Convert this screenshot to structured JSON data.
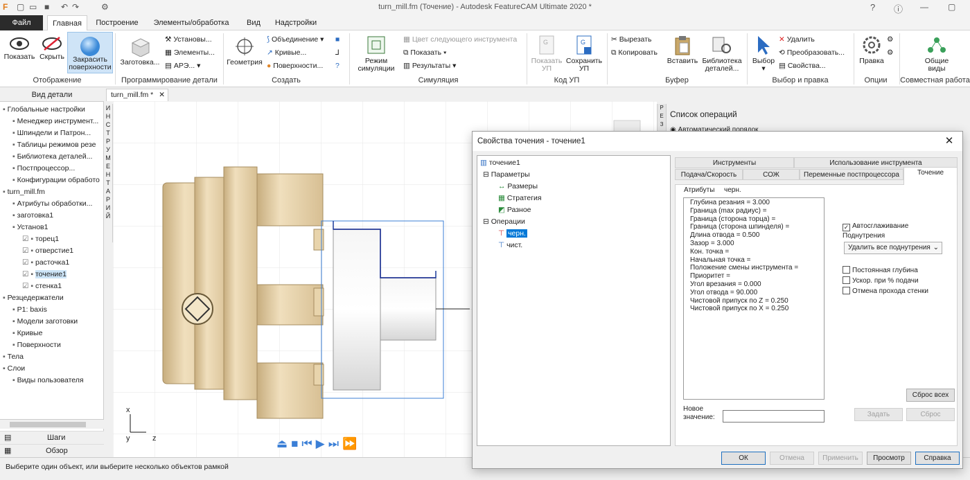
{
  "window": {
    "title": "turn_mill.fm (Точение) - Autodesk FeatureCAM Ultimate 2020 *"
  },
  "menu": {
    "file": "Файл",
    "tabs": [
      "Главная",
      "Построение",
      "Элементы/обработка",
      "Вид",
      "Надстройки"
    ]
  },
  "ribbon": {
    "display": {
      "show": "Показать",
      "hide": "Скрыть",
      "shade": "Закрасить\nповерхности",
      "label": "Отображение"
    },
    "partprog": {
      "stock": "Заготовка...",
      "setups": "Установы...",
      "features": "Элементы...",
      "ape": "АРЭ...",
      "label": "Программирование детали"
    },
    "create": {
      "geometry": "Геометрия",
      "union": "Объединение",
      "curves": "Кривые...",
      "surfaces": "Поверхности...",
      "label": "Создать"
    },
    "sim": {
      "mode": "Режим\nсимуляции",
      "next_tool_color": "Цвет следующего инструмента",
      "show": "Показать",
      "results": "Результаты",
      "label": "Симуляция"
    },
    "nc": {
      "show_nc": "Показать\nУП",
      "save_nc": "Сохранить\nУП",
      "label": "Код УП"
    },
    "clipboard": {
      "cut": "Вырезать",
      "copy": "Копировать",
      "paste": "Вставить",
      "library": "Библиотека\nдеталей...",
      "label": "Буфер"
    },
    "select": {
      "select": "Выбор",
      "delete": "Удалить",
      "transform": "Преобразовать...",
      "properties": "Свойства...",
      "label": "Выбор и правка"
    },
    "options": {
      "edit": "Правка",
      "label": "Опции"
    },
    "collab": {
      "shared_views": "Общие\nвиды",
      "label": "Совместная работа"
    }
  },
  "left_panel": {
    "header": "Вид детали",
    "tree": [
      {
        "label": "Глобальные настройки",
        "level": 0
      },
      {
        "label": "Менеджер инструмент...",
        "level": 1
      },
      {
        "label": "Шпиндели и Патрон...",
        "level": 1
      },
      {
        "label": "Таблицы режимов резе",
        "level": 1
      },
      {
        "label": "Библиотека деталей...",
        "level": 1
      },
      {
        "label": "Постпроцессор...",
        "level": 1
      },
      {
        "label": "Конфигурации обработо",
        "level": 1
      },
      {
        "label": "turn_mill.fm",
        "level": 0
      },
      {
        "label": "Атрибуты обработки...",
        "level": 1
      },
      {
        "label": "заготовка1",
        "level": 1
      },
      {
        "label": "Установ1",
        "level": 1
      },
      {
        "label": "торец1",
        "level": 2
      },
      {
        "label": "отверстие1",
        "level": 2
      },
      {
        "label": "расточка1",
        "level": 2
      },
      {
        "label": "точение1",
        "level": 2
      },
      {
        "label": "стенка1",
        "level": 2
      },
      {
        "label": "Резцедержатели",
        "level": 0
      },
      {
        "label": "P1: baxis",
        "level": 1
      },
      {
        "label": "Модели заготовки",
        "level": 1
      },
      {
        "label": "Кривые",
        "level": 1
      },
      {
        "label": "Поверхности",
        "level": 1
      },
      {
        "label": "Тела",
        "level": 0
      },
      {
        "label": "Слои",
        "level": 0
      },
      {
        "label": "Виды пользователя",
        "level": 1
      }
    ],
    "bottom": {
      "steps": "Шаги",
      "overview": "Обзор"
    },
    "vertical_tab": "ИНСТРУМЕНТАРИЙ"
  },
  "document": {
    "tab": "turn_mill.fm *"
  },
  "viewport": {
    "axis_x": "x",
    "axis_y": "y",
    "axis_z": "z"
  },
  "right_panel": {
    "title": "Список операций",
    "auto_order": "Автоматический порядок"
  },
  "dialog": {
    "title": "Свойства точения - точение1",
    "close": "✕",
    "tree": {
      "root": "точение1",
      "params": "Параметры",
      "sizes": "Размеры",
      "strategy": "Стратегия",
      "misc": "Разное",
      "operations": "Операции",
      "rough": "черн.",
      "finish": "чист."
    },
    "tabs_row1": [
      "Инструменты",
      "Использование инструмента"
    ],
    "tabs_row2": [
      "Подача/Скорость",
      "СОЖ",
      "Переменные постпроцессора",
      "Точение"
    ],
    "attr_label": "Атрибуты",
    "attr_op": "черн.",
    "attributes": [
      "Глубина резания = 3.000",
      "Граница (max радиус) =",
      "Граница (сторона торца) =",
      "Граница (сторона шпинделя) =",
      "Длина отвода = 0.500",
      "Зазор = 3.000",
      "Кон. точка =",
      "Начальная точка =",
      "Положение смены инструмента =",
      "Приоритет =",
      "Угол врезания = 0.000",
      "Угол отвода = 90.000",
      "Чистовой припуск по Z = 0.250",
      "Чистовой припуск по X = 0.250"
    ],
    "auto_smooth": "Автосглаживание",
    "undercuts_label": "Поднутрения",
    "undercuts_value": "Удалить все поднутрения",
    "const_depth": "Постоянная глубина",
    "accel_feed": "Ускор. при % подачи",
    "cancel_wall": "Отмена прохода стенки",
    "reset_all": "Сброс всех",
    "new_value_label": "Новое\nзначение:",
    "set": "Задать",
    "reset": "Сброс",
    "ok": "ОК",
    "cancel": "Отмена",
    "apply": "Применить",
    "view": "Просмотр",
    "help": "Справка"
  },
  "status": {
    "text": "Выберите один объект, или выберите несколько объектов рамкой"
  },
  "colors": {
    "accent": "#2b5797",
    "file_tab": "#2b2b2b",
    "part": "#e3cfa4",
    "selection": "#0078d7"
  }
}
